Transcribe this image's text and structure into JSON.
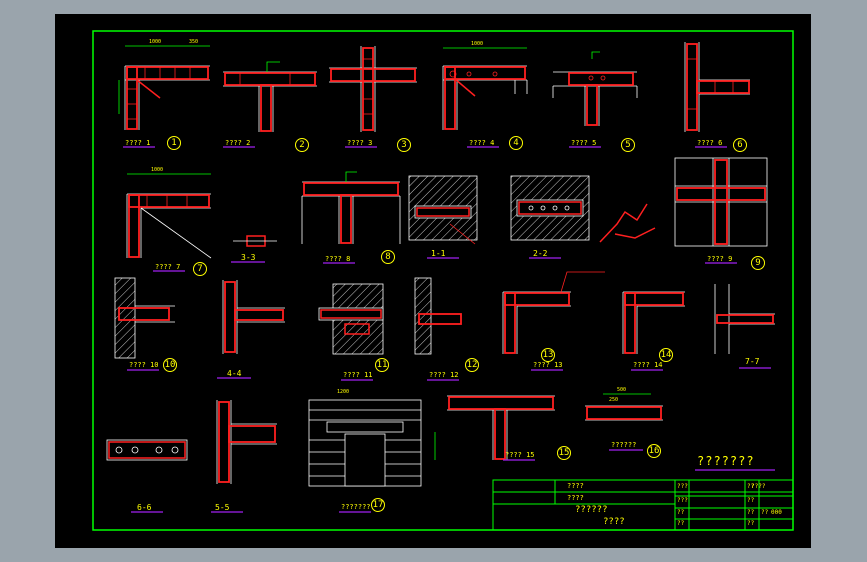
{
  "colors": {
    "background": "#9aa4ac",
    "sheet": "#000000",
    "frame": "#00ff00",
    "rebar": "#ff2020",
    "text": "#ffff00",
    "hatch": "#ffffff",
    "underline": "#a020f0"
  },
  "details": [
    {
      "caption": "???? 1",
      "num": "1"
    },
    {
      "caption": "???? 2",
      "num": "2"
    },
    {
      "caption": "???? 3",
      "num": "3"
    },
    {
      "caption": "???? 4",
      "num": "4"
    },
    {
      "caption": "???? 5",
      "num": "5"
    },
    {
      "caption": "???? 6",
      "num": "6"
    },
    {
      "caption": "???? 7",
      "num": "7"
    },
    {
      "caption": "???? 8",
      "num": "8"
    },
    {
      "caption": "???? 9",
      "num": "9"
    },
    {
      "caption": "???? 10",
      "num": "10"
    },
    {
      "caption": "???? 11",
      "num": "11"
    },
    {
      "caption": "???? 12",
      "num": "12"
    },
    {
      "caption": "???? 13",
      "num": "13"
    },
    {
      "caption": "???? 14",
      "num": "14"
    },
    {
      "caption": "???? 15",
      "num": "15"
    },
    {
      "caption": "??????",
      "num": "16"
    },
    {
      "caption": "???????",
      "num": "17"
    }
  ],
  "sections": [
    "3-3",
    "1-1",
    "2-2",
    "4-4",
    "7-7",
    "6-6",
    "5-5"
  ],
  "dims": {
    "d1000": "1000",
    "d350": "350",
    "d250": "250",
    "d500": "500",
    "d1200": "1200"
  },
  "notes": {
    "general_title": "???????"
  },
  "title_block": {
    "r1": "????",
    "r2": "????",
    "r3": "??????",
    "r4": "????",
    "c1": "???",
    "c2": "???",
    "c3": "??",
    "c4": "??",
    "c5": "??",
    "c6": "??",
    "v1": "????",
    "v2": "??",
    "v3": "??",
    "v4": "??",
    "v5": "000"
  }
}
